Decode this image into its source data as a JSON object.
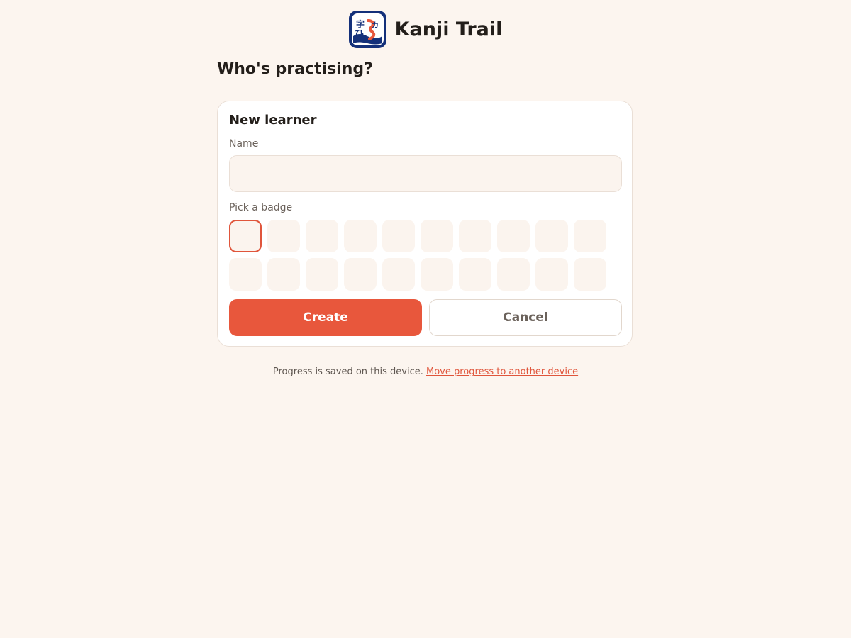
{
  "app": {
    "title": "Kanji Trail",
    "logo_icon": "kanji-trail-logo-icon"
  },
  "prompt": "Who's practising?",
  "new_learner": {
    "title": "New learner",
    "name_label": "Name",
    "name_value": "",
    "name_placeholder": "",
    "badge_label": "Pick a badge",
    "badge_count": 20,
    "selected_badge_index": 0,
    "create_label": "Create",
    "cancel_label": "Cancel"
  },
  "footer": {
    "text": "Progress is saved on this device.",
    "link_label": "Move progress to another device"
  },
  "colors": {
    "background": "#fcf5ef",
    "accent": "#e8573c",
    "card": "#ffffff",
    "input_fill": "#fbf4ee",
    "logo_navy": "#14307a"
  }
}
